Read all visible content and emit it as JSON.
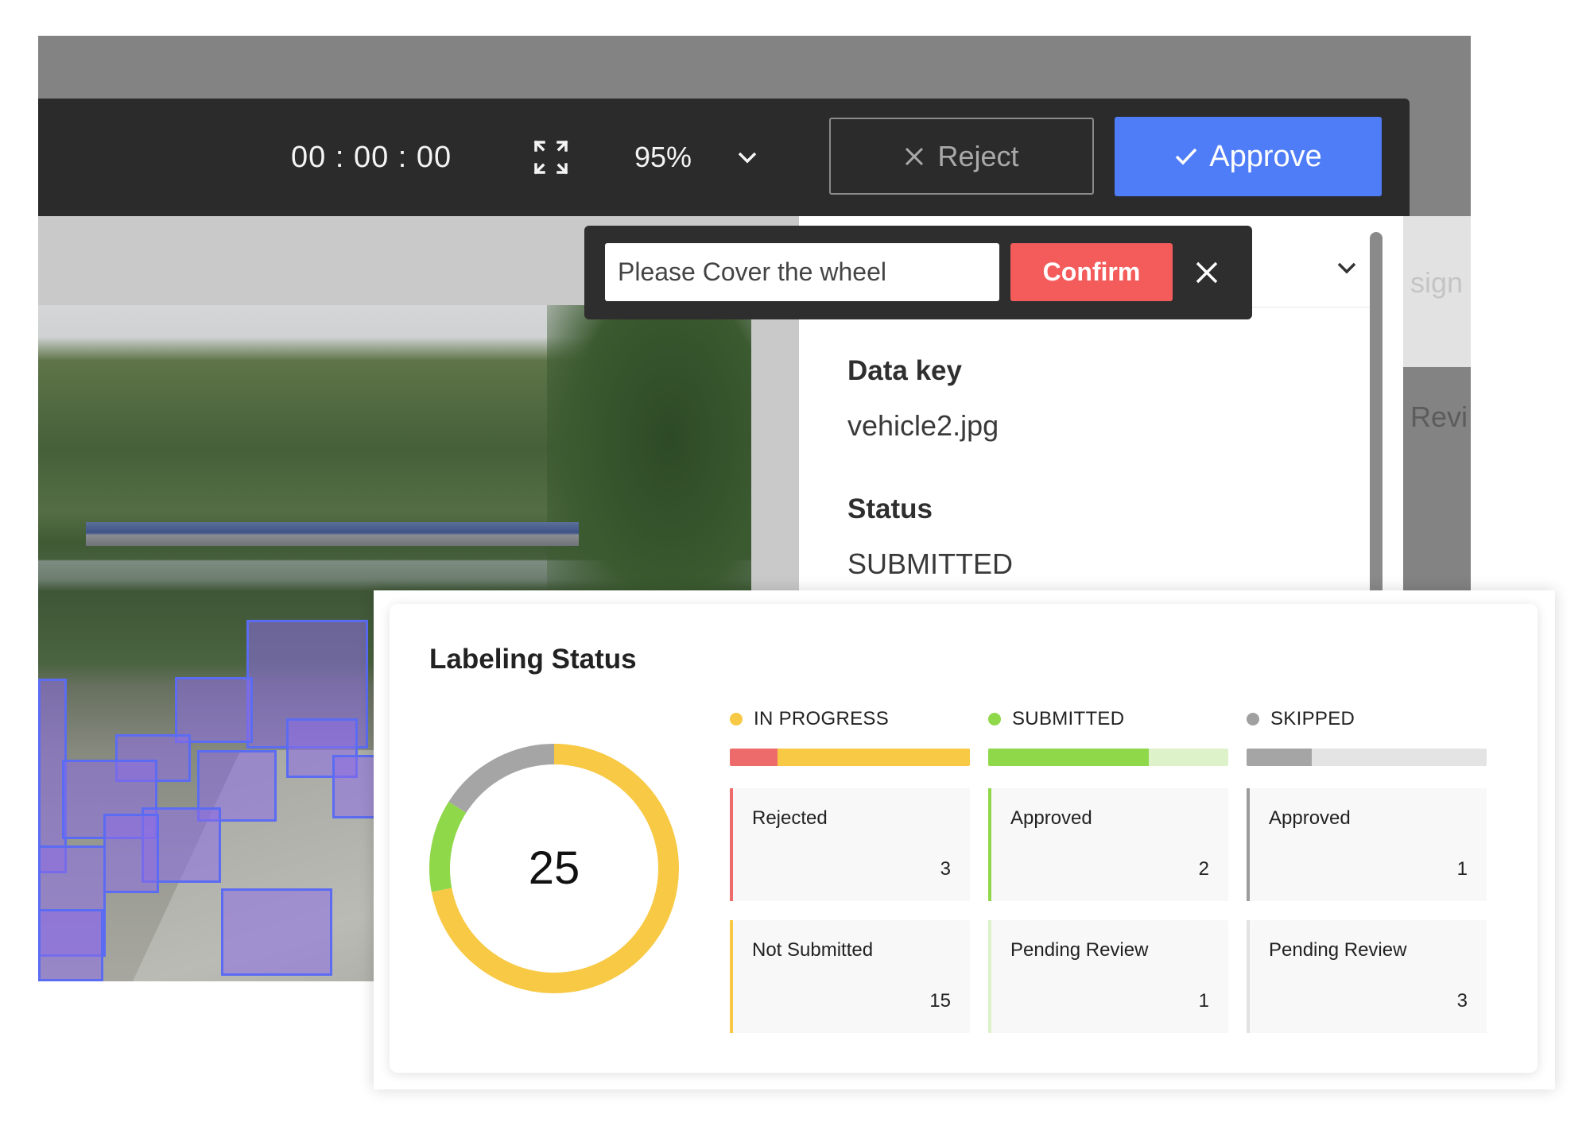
{
  "toolbar": {
    "timer": "00 : 00 : 00",
    "zoom": "95%",
    "reject_label": "Reject",
    "approve_label": "Approve"
  },
  "reject_popup": {
    "comment_value": "Please Cover the wheel",
    "confirm_label": "Confirm"
  },
  "info_panel": {
    "data_key_label": "Data key",
    "data_key_value": "vehicle2.jpg",
    "status_label": "Status",
    "status_value": "SUBMITTED",
    "side_tab_top": "sign",
    "side_tab_review": "Revi"
  },
  "labeling_status": {
    "title": "Labeling Status",
    "total": "25",
    "columns": [
      {
        "header": "IN PROGRESS",
        "color": "#f7c944",
        "bar": [
          {
            "color": "#ee6b6b",
            "fraction": 0.2
          },
          {
            "color": "#f7c944",
            "fraction": 0.8
          }
        ],
        "stats": [
          {
            "label": "Rejected",
            "value": "3",
            "accent": "#ee6b6b"
          },
          {
            "label": "Not Submitted",
            "value": "15",
            "accent": "#f7c944"
          }
        ]
      },
      {
        "header": "SUBMITTED",
        "color": "#8fd84a",
        "bar": [
          {
            "color": "#8fd84a",
            "fraction": 0.67
          },
          {
            "color": "#def2c9",
            "fraction": 0.33
          }
        ],
        "stats": [
          {
            "label": "Approved",
            "value": "2",
            "accent": "#8fd84a"
          },
          {
            "label": "Pending Review",
            "value": "1",
            "accent": "#def2c9"
          }
        ]
      },
      {
        "header": "SKIPPED",
        "color": "#a0a0a0",
        "bar": [
          {
            "color": "#a5a5a5",
            "fraction": 0.27
          },
          {
            "color": "#e4e4e4",
            "fraction": 0.73
          }
        ],
        "stats": [
          {
            "label": "Approved",
            "value": "1",
            "accent": "#9b9b9b"
          },
          {
            "label": "Pending Review",
            "value": "3",
            "accent": "#e2e2e2"
          }
        ]
      }
    ],
    "donut": [
      {
        "name": "in-progress",
        "value": 18,
        "color": "#f7c944"
      },
      {
        "name": "submitted",
        "value": 3,
        "color": "#8fd84a"
      },
      {
        "name": "skipped",
        "value": 4,
        "color": "#a5a5a5"
      }
    ]
  },
  "colors": {
    "approve": "#4f7df7",
    "confirm": "#f45b5b",
    "bbox": "#5b6cf2"
  }
}
